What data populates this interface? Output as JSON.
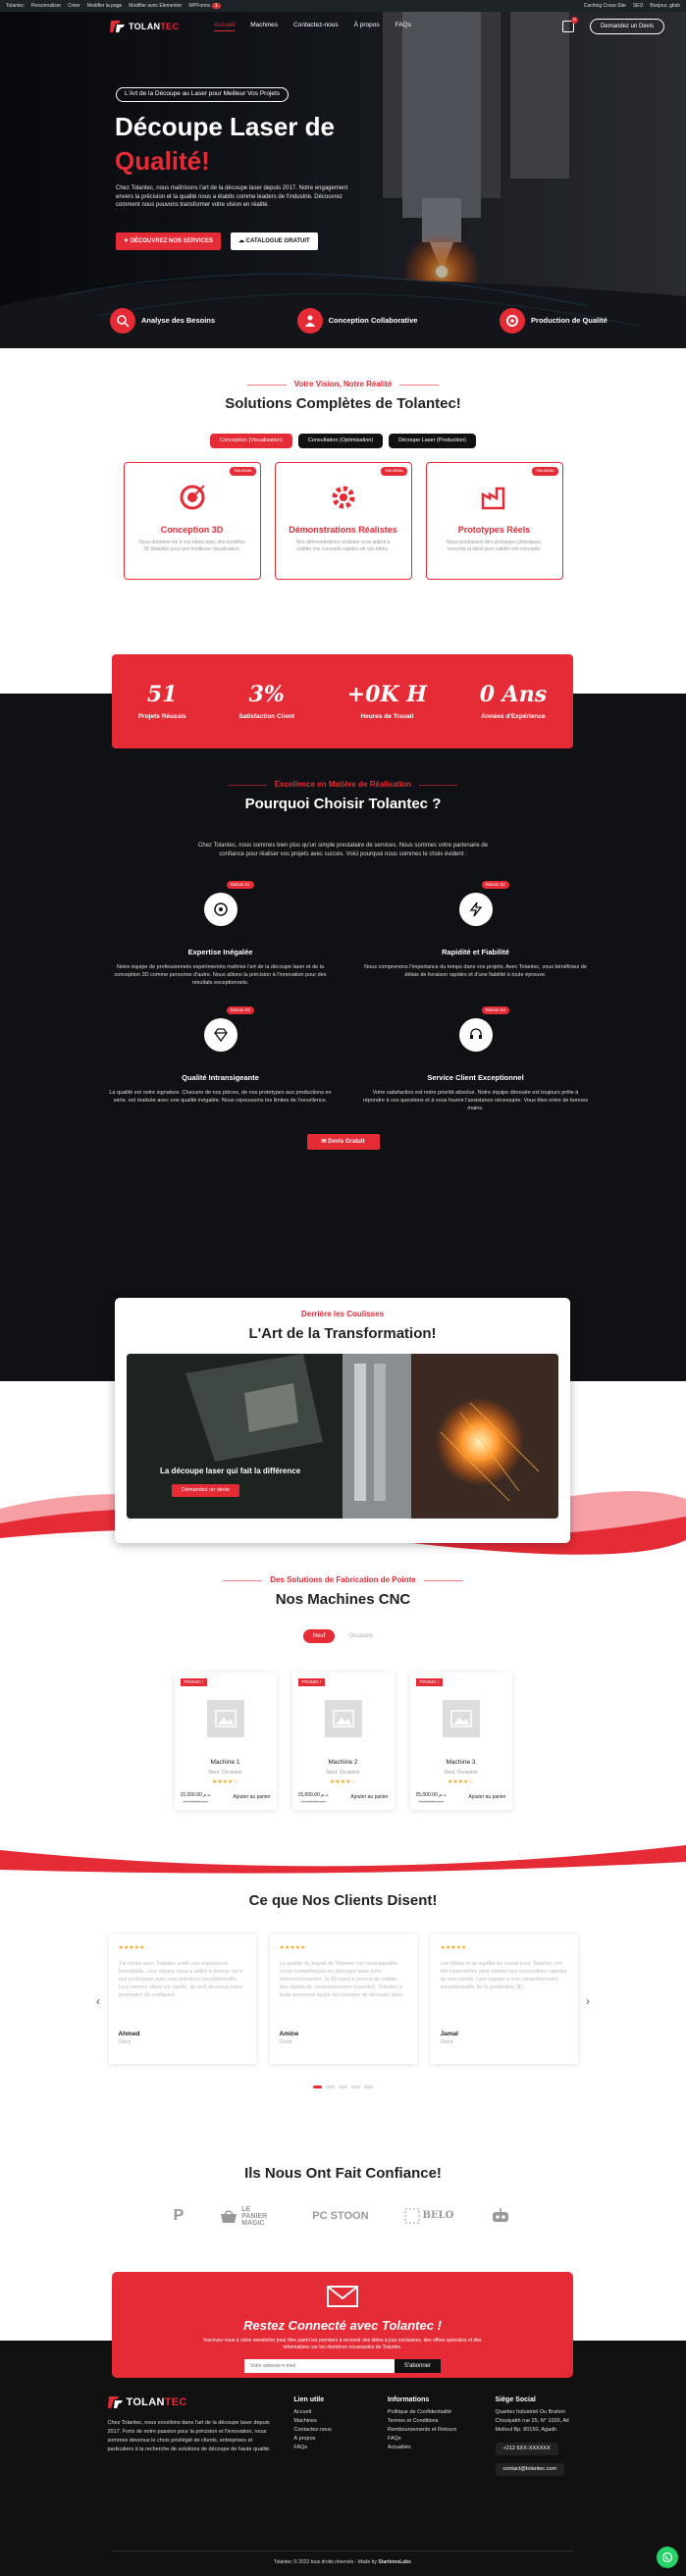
{
  "admin_bar": {
    "left": [
      "Tolantec",
      "Personnaliser",
      "Créer",
      "Modifier la page",
      "Modifier avec Elementor",
      "WPForms"
    ],
    "wpforms_count": "1",
    "right": [
      "Caching Cross-Site",
      "Bonjour, gbsb"
    ],
    "seo": "SEO"
  },
  "nav": {
    "logo_main": "TOLAN",
    "logo_accent": "TEC",
    "menu": [
      "Accueil",
      "Machines",
      "Contactez-nous",
      "À propos",
      "FAQs"
    ],
    "cart_count": "0",
    "quote_button": "Demandez un Devis"
  },
  "hero": {
    "pill": "L'Art de la Découpe au Laser pour Meilleur Vos Projets",
    "title_line1": "Découpe Laser de",
    "title_line2": "Qualité!",
    "lead": "Chez Tolantec, nous maîtrisons l'art de la découpe laser depuis 2017. Notre engagement envers la précision et la qualité nous a établis comme leaders de l'industrie. Découvrez comment nous pouvons transformer votre vision en réalité.",
    "cta_primary": "DÉCOUVREZ NOS SERVICES",
    "cta_secondary": "CATALOGUE GRATUIT",
    "features": [
      "Analyse des Besoins",
      "Conception Collaborative",
      "Production de Qualité"
    ]
  },
  "vision": {
    "kicker": "Votre Vision, Notre Réalité",
    "title_bold": "Solutions",
    "title_rest": " Complètes de Tolantec!",
    "tabs": [
      "Conception (Visualisation)",
      "Consultation (Optimisation)",
      "Découpe Laser (Production)"
    ],
    "cards": [
      {
        "badge": "Nouveau",
        "title": "Conception 3D",
        "text": "Nous donnons vie à vos idées avec des modèles 3D détaillés pour une meilleure visualisation."
      },
      {
        "badge": "Nouveau",
        "title": "Démonstrations Réalistes",
        "text": "Nos démonstrations réalistes vous aident à valider vos concepts rapides de vos idées."
      },
      {
        "badge": "Nouveau",
        "title": "Prototypes Réels",
        "text": "Nous produisons des prototypes physiques, concrets et idéal pour valider vos concepts."
      }
    ]
  },
  "stats": [
    {
      "num": "51",
      "label": "Projets Réussis"
    },
    {
      "num": "3%",
      "label": "Satisfaction Client"
    },
    {
      "num": "+0K H",
      "label": "Heures de Travail"
    },
    {
      "num": "0 Ans",
      "label": "Années d'Expérience"
    }
  ],
  "why": {
    "kicker": "Excellence en Matière de Réalisation",
    "title_pre": "Pourquoi Choisir ",
    "title_bold": "Tolantec",
    "title_post": " ?",
    "intro": "Chez Tolantec, nous sommes bien plus qu'un simple prestataire de services. Nous sommes votre partenaire de confiance pour réaliser vos projets avec succès. Voici pourquoi nous sommes le choix évident :",
    "items": [
      {
        "tag": "Raison 01",
        "title": "Expertise Inégalée",
        "text": "Notre équipe de professionnels expérimentés maîtrise l'art de la découpe laser et de la conception 3D comme personne d'autre. Nous allions la précision à l'innovation pour des résultats exceptionnels."
      },
      {
        "tag": "Raison 02",
        "title": "Rapidité et Fiabilité",
        "text": "Nous comprenons l'importance du temps dans vos projets. Avec Tolantec, vous bénéficiez de délais de livraison rapides et d'une fiabilité à toute épreuve."
      },
      {
        "tag": "Raison 03",
        "title": "Qualité Intransigeante",
        "text": "La qualité est notre signature. Chacune de nos pièces, de nos prototypes aux productions en série, est réalisée avec une qualité inégalée. Nous repoussons les limites de l'excellence."
      },
      {
        "tag": "Raison 04",
        "title": "Service Client Exceptionnel",
        "text": "Votre satisfaction est notre priorité absolue. Notre équipe dévouée est toujours prête à répondre à vos questions et à vous fournir l'assistance nécessaire. Vous êtes entre de bonnes mains."
      }
    ],
    "button": "Devis Gratuit"
  },
  "transform": {
    "kicker": "Derrière les Coulisses",
    "title_pre": "L'Art de la ",
    "title_bold": "Transformation",
    "title_post": "!",
    "caption": "La découpe laser qui fait la différence",
    "button": "Demandez un devis"
  },
  "machines": {
    "kicker": "Des Solutions de Fabrication de Pointe",
    "title_pre": "Nos ",
    "title_bold": "Machines",
    "title_post": " CNC",
    "toggle": [
      "Neuf",
      "Occasion"
    ],
    "products": [
      {
        "promo": "PROMO !",
        "name": "Machine 1",
        "cat": "Neuf, Occasion",
        "price": "15,000.00 د.م.",
        "old": "17,000.00 د.م.",
        "cart": "Ajouter au panier"
      },
      {
        "promo": "PROMO !",
        "name": "Machine 2",
        "cat": "Neuf, Occasion",
        "price": "15,600.00 د.م.",
        "old": "17,000.00 د.م.",
        "cart": "Ajouter au panier"
      },
      {
        "promo": "PROMO !",
        "name": "Machine 3",
        "cat": "Neuf, Occasion",
        "price": "25,000.00 د.م.",
        "old": "28,000.00 د.م.",
        "cart": "Ajouter au panier"
      }
    ]
  },
  "testimonials": {
    "title_pre": "Ce que Nos ",
    "title_bold": "Clients",
    "title_post": " Disent!",
    "items": [
      {
        "stars": "★★★★★",
        "text": "J'ai choisi avec Tolantec a été une expérience formidable. Leur équipe nous a aidés à donner vie à nos prototypes avec une précision exceptionnelle. Leur service client est rapide, ils sont devenus notre partenaire de confiance.",
        "name": "Ahmed",
        "role": "Client"
      },
      {
        "stars": "★★★★★",
        "text": "La qualité du travail de Tolantec est incomparable. Leurs compétences en découpe laser sont impressionnantes, la 3D nous a permis de valider des détails de reconnaissance essentiel. Tolantec à toute personne ayant des besoins de découpe laser.",
        "name": "Amine",
        "role": "Client"
      },
      {
        "stars": "★★★★★",
        "text": "Les délais et la rapidité du travail pour Tolantec ont été essentielles pour valider nos conceptions rapides de nos clients. Leur équipe a une compréhension exceptionnelle de la production 3D.",
        "name": "Jamal",
        "role": "Client"
      }
    ]
  },
  "trust": {
    "title_pre": "Ils Nous Ont Fait ",
    "title_bold": "Confiance",
    "title_post": "!",
    "logos": [
      "P",
      "LE PANIER MAGIC",
      "PC STOON",
      "BELO",
      "ROBOT"
    ]
  },
  "newsletter": {
    "title": "Restez Connecté avec Tolantec !",
    "text": "Inscrivez-vous à notre newsletter pour être parmi les premiers à recevoir des idées à jour exclusives, des offres spéciales et des informations sur les dernières nouveautés de Tolantec.",
    "placeholder": "Votre adresse e-mail",
    "button": "S'abonner"
  },
  "footer": {
    "about": "Chez Tolantec, nous excellons dans l'art de la découpe laser depuis 2017. Forts de notre passion pour la précision et l'innovation, nous sommes devenus le choix privilégié de clients, entreprises et particuliers à la recherche de solutions de découpe de haute qualité.",
    "useful_title": "Lien utile",
    "useful": [
      "Accueil",
      "Machines",
      "Contactez-nous",
      "À propos",
      "FAQs"
    ],
    "info_title": "Informations",
    "info": [
      "Politique de Confidentialité",
      "Termes et Conditions",
      "Remboursements et Retours",
      "FAQs",
      "Actualités"
    ],
    "office_title": "Siège Social",
    "office": "Quartier Industriel Ou Brahim Chouiyakh rue 25, N° 1026, Ait Melloul Bp. 80150, Agadir.",
    "phone": "+212 6XX-XXXXXX",
    "email": "contact@tolantec.com",
    "copyright_pre": "Tolantec © 2022 tous droits réservés - Made by ",
    "copyright_brand": "StartinnoLabs"
  },
  "colors": {
    "accent": "#e52b36",
    "dark": "#101114"
  }
}
